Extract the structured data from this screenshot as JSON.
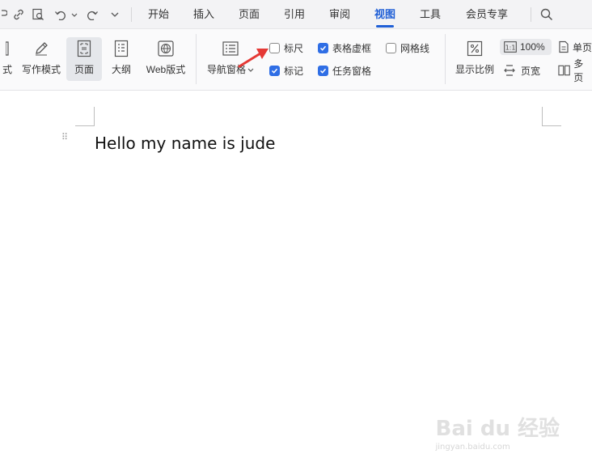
{
  "tabs": [
    {
      "label": "开始"
    },
    {
      "label": "插入"
    },
    {
      "label": "页面"
    },
    {
      "label": "引用"
    },
    {
      "label": "审阅"
    },
    {
      "label": "视图",
      "active": true
    },
    {
      "label": "工具"
    },
    {
      "label": "会员专享"
    }
  ],
  "ribbon": {
    "partial_left": "式",
    "writing_mode": "写作模式",
    "page": "页面",
    "outline": "大纲",
    "web_layout": "Web版式",
    "nav_pane": "导航窗格",
    "ruler": "标尺",
    "table_grid": "表格虚框",
    "gridlines": "网格线",
    "marks": "标记",
    "task_pane": "任务窗格",
    "zoom": "显示比例",
    "zoom_100": "100%",
    "page_width": "页宽",
    "single_page": "单页",
    "multi_page": "多页"
  },
  "checkboxes": {
    "ruler": false,
    "table_grid": true,
    "gridlines": false,
    "marks": true,
    "task_pane": true
  },
  "document": {
    "text": "Hello my name is jude"
  },
  "watermark": {
    "brand": "Bai du 经验",
    "url": "jingyan.baidu.com"
  },
  "colors": {
    "accent": "#1f5fd6",
    "checkbox_on": "#2f6ee5",
    "annotation_arrow": "#e53935"
  }
}
